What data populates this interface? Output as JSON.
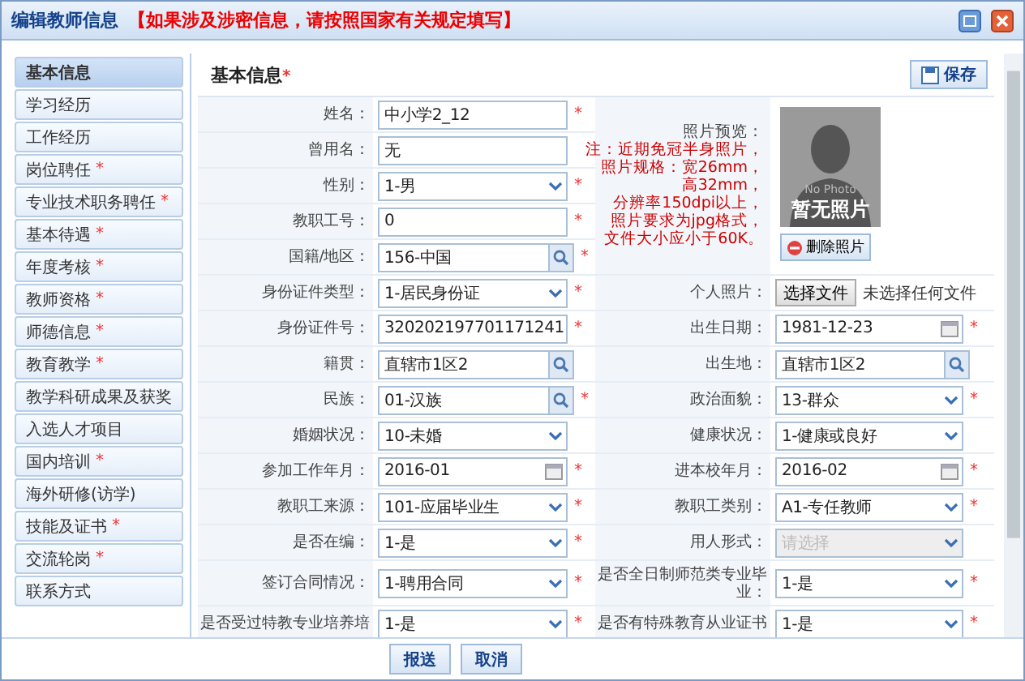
{
  "window": {
    "title": "编辑教师信息",
    "notice": "【如果涉及涉密信息，请按照国家有关规定填写】"
  },
  "required_mark": "*",
  "sidebar": {
    "items": [
      {
        "label": "基本信息",
        "selected": true,
        "required": false
      },
      {
        "label": "学习经历",
        "selected": false,
        "required": false
      },
      {
        "label": "工作经历",
        "selected": false,
        "required": false
      },
      {
        "label": "岗位聘任",
        "selected": false,
        "required": true
      },
      {
        "label": "专业技术职务聘任",
        "selected": false,
        "required": true
      },
      {
        "label": "基本待遇",
        "selected": false,
        "required": true
      },
      {
        "label": "年度考核",
        "selected": false,
        "required": true
      },
      {
        "label": "教师资格",
        "selected": false,
        "required": true
      },
      {
        "label": "师德信息",
        "selected": false,
        "required": true
      },
      {
        "label": "教育教学",
        "selected": false,
        "required": true
      },
      {
        "label": "教学科研成果及获奖",
        "selected": false,
        "required": false
      },
      {
        "label": "入选人才项目",
        "selected": false,
        "required": false
      },
      {
        "label": "国内培训",
        "selected": false,
        "required": true
      },
      {
        "label": "海外研修(访学)",
        "selected": false,
        "required": false
      },
      {
        "label": "技能及证书",
        "selected": false,
        "required": true
      },
      {
        "label": "交流轮岗",
        "selected": false,
        "required": true
      },
      {
        "label": "联系方式",
        "selected": false,
        "required": false
      }
    ]
  },
  "section": {
    "title": "基本信息",
    "required": true,
    "save_button": "保存"
  },
  "top_fields": [
    {
      "label": "姓名：",
      "value": "中小学2_12",
      "kind": "text",
      "required": true
    },
    {
      "label": "曾用名：",
      "value": "无",
      "kind": "text",
      "required": false
    },
    {
      "label": "性别：",
      "value": "1-男",
      "kind": "select",
      "required": true
    },
    {
      "label": "教职工号：",
      "value": "0",
      "kind": "text",
      "required": true
    },
    {
      "label": "国籍/地区：",
      "value": "156-中国",
      "kind": "lookup",
      "required": true
    }
  ],
  "photo": {
    "label": "照片预览：",
    "notes": [
      "注：近期免冠半身照片，",
      "照片规格：宽26mm，",
      "高32mm，",
      "分辨率150dpi以上，",
      "照片要求为jpg格式，",
      "文件大小应小于60K。"
    ],
    "placeholder_caption": "No Photo",
    "placeholder_title": "暂无照片",
    "delete_button": "删除照片"
  },
  "rows": [
    {
      "left": {
        "label": "身份证件类型：",
        "value": "1-居民身份证",
        "kind": "select",
        "required": true
      },
      "right": {
        "label": "个人照片：",
        "button": "选择文件",
        "value": "未选择任何文件",
        "kind": "file",
        "required": false
      }
    },
    {
      "left": {
        "label": "身份证件号：",
        "value": "320202197701171241",
        "kind": "text",
        "required": true
      },
      "right": {
        "label": "出生日期：",
        "value": "1981-12-23",
        "kind": "date",
        "required": true
      }
    },
    {
      "left": {
        "label": "籍贯：",
        "value": "直辖市1区2",
        "kind": "lookup",
        "required": false
      },
      "right": {
        "label": "出生地：",
        "value": "直辖市1区2",
        "kind": "lookup",
        "required": false
      }
    },
    {
      "left": {
        "label": "民族：",
        "value": "01-汉族",
        "kind": "lookup",
        "required": true
      },
      "right": {
        "label": "政治面貌：",
        "value": "13-群众",
        "kind": "select",
        "required": true
      }
    },
    {
      "left": {
        "label": "婚姻状况：",
        "value": "10-未婚",
        "kind": "select",
        "required": false
      },
      "right": {
        "label": "健康状况：",
        "value": "1-健康或良好",
        "kind": "select",
        "required": false
      }
    },
    {
      "left": {
        "label": "参加工作年月：",
        "value": "2016-01",
        "kind": "date",
        "required": true
      },
      "right": {
        "label": "进本校年月：",
        "value": "2016-02",
        "kind": "date",
        "required": true
      }
    },
    {
      "left": {
        "label": "教职工来源：",
        "value": "101-应届毕业生",
        "kind": "select",
        "required": true
      },
      "right": {
        "label": "教职工类别：",
        "value": "A1-专任教师",
        "kind": "select",
        "required": true
      }
    },
    {
      "left": {
        "label": "是否在编：",
        "value": "1-是",
        "kind": "select",
        "required": true
      },
      "right": {
        "label": "用人形式：",
        "placeholder": "请选择",
        "kind": "select",
        "required": false,
        "disabled": true
      }
    },
    {
      "left": {
        "label": "签订合同情况：",
        "value": "1-聘用合同",
        "kind": "select",
        "required": true
      },
      "right": {
        "label": "是否全日制师范类专业毕业：",
        "value": "1-是",
        "kind": "select",
        "required": true
      }
    },
    {
      "left": {
        "label": "是否受过特教专业培养培",
        "value": "1-是",
        "kind": "select",
        "required": true
      },
      "right": {
        "label": "是否有特殊教育从业证书",
        "value": "1-是",
        "kind": "select",
        "required": true
      }
    }
  ],
  "footer": {
    "buttons": [
      "报送",
      "取消"
    ]
  }
}
